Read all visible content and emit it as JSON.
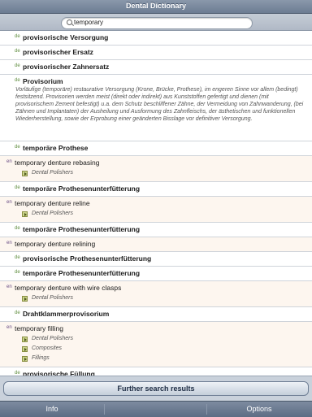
{
  "app_title": "Dental Dictionary",
  "search": {
    "query": "temporary",
    "icon": "search-icon"
  },
  "rows": [
    {
      "lang": "de",
      "term": "provisorische Versorgung"
    },
    {
      "lang": "de",
      "term": "provisorischer Ersatz"
    },
    {
      "lang": "de",
      "term": "provisorischer Zahnersatz"
    },
    {
      "lang": "de",
      "term": "Provisorium",
      "definition": "Vorläufige (temporäre) restaurative Versorgung (Krone, Brücke, Prothese), im engeren Sinne vor allem (bedingt) festsitzend. Provisorien werden meist (direkt oder indirekt) aus Kunststoffen gefertigt und dienen (mit provisorischem Zement befestigt) u.a. dem Schutz beschliffener Zähne, der Vermeidung von Zahnwanderung, (bei Zähnen und Implantaten) der Ausheilung und Ausformung des Zahnfleischs, der ästhetischen und funktionellen Wiederherstellung, sowie der Erprobung einer geänderten Bisslage vor definitiver Versorgung."
    },
    {
      "lang": "de",
      "term": "temporäre Prothese"
    },
    {
      "lang": "en",
      "term": "temporary denture rebasing",
      "categories": [
        "Dental Polishers"
      ]
    },
    {
      "lang": "de",
      "term": "temporäre Prothesenunterfütterung"
    },
    {
      "lang": "en",
      "term": "temporary denture reline",
      "categories": [
        "Dental Polishers"
      ]
    },
    {
      "lang": "de",
      "term": "temporäre Prothesenunterfütterung"
    },
    {
      "lang": "en",
      "term": "temporary denture relining"
    },
    {
      "lang": "de",
      "term": "provisorische Prothesenunterfütterung"
    },
    {
      "lang": "de",
      "term": "temporäre Prothesenunterfütterung"
    },
    {
      "lang": "en",
      "term": "temporary denture with wire clasps",
      "categories": [
        "Dental Polishers"
      ]
    },
    {
      "lang": "de",
      "term": "Drahtklammerprovisorium"
    },
    {
      "lang": "en",
      "term": "temporary filling",
      "categories": [
        "Dental Polishers",
        "Composites",
        "Fillings"
      ]
    },
    {
      "lang": "de",
      "term": "provisorische Füllung"
    }
  ],
  "further_button": "Further search results",
  "tabs": {
    "info": "Info",
    "options": "Options"
  }
}
